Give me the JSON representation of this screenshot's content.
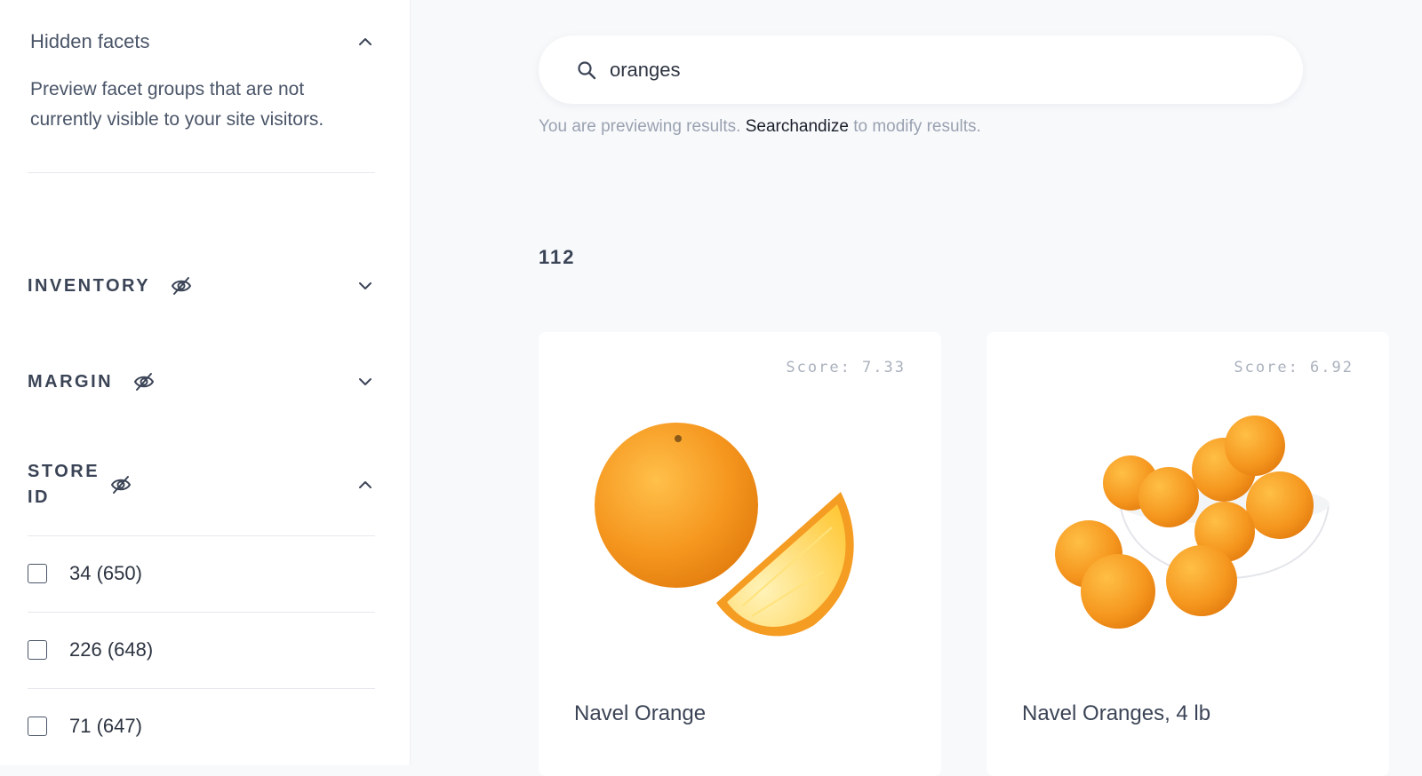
{
  "sidebar": {
    "hidden_facets": {
      "title": "Hidden facets",
      "description": "Preview facet groups that are not currently visible to your site visitors."
    },
    "facets": [
      {
        "label": "INVENTORY",
        "expanded": false,
        "hidden": true
      },
      {
        "label": "MARGIN",
        "expanded": false,
        "hidden": true
      },
      {
        "label": "STORE ID",
        "expanded": true,
        "hidden": true
      }
    ],
    "store_options": [
      {
        "label": "34 (650)",
        "checked": false
      },
      {
        "label": "226 (648)",
        "checked": false
      },
      {
        "label": "71 (647)",
        "checked": false
      }
    ]
  },
  "search": {
    "value": "oranges",
    "note_prefix": "You are previewing results.",
    "note_link": "Searchandize",
    "note_suffix": "to modify results."
  },
  "results": {
    "count": "112",
    "items": [
      {
        "score": "Score: 7.33",
        "title": "Navel Orange",
        "image": "orange-with-slice"
      },
      {
        "score": "Score: 6.92",
        "title": "Navel Oranges, 4 lb",
        "image": "oranges-in-bowl"
      }
    ]
  },
  "colors": {
    "accent_orange": "#f39a1c",
    "text_dark": "#3b4456",
    "muted": "#9aa2b1",
    "background": "#f8f9fb"
  }
}
